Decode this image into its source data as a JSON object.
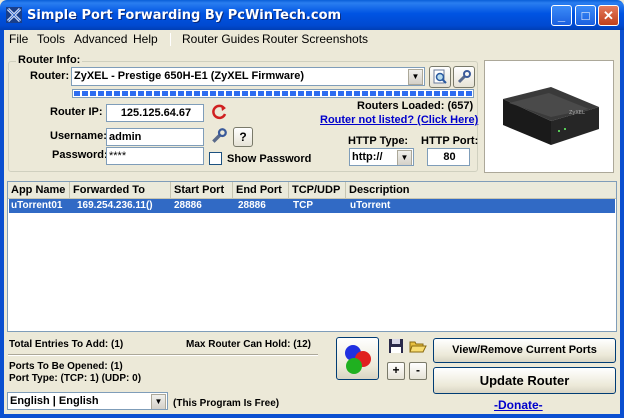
{
  "window": {
    "title": "Simple Port Forwarding By PcWinTech.com",
    "minimize": "_",
    "maximize": "□",
    "close": "✕"
  },
  "menu": {
    "file": "File",
    "tools": "Tools",
    "advanced": "Advanced",
    "help": "Help",
    "router_guides": "Router Guides",
    "router_screenshots": "Router Screenshots"
  },
  "router_info": {
    "group_label": "Router Info:",
    "router_label": "Router:",
    "router_value": "ZyXEL - Prestige 650H-E1 (ZyXEL Firmware)",
    "router_ip_label": "Router IP:",
    "router_ip_value": "125.125.64.67",
    "routers_loaded": "Routers Loaded: (657)",
    "router_not_listed": "Router not listed? (Click Here)",
    "username_label": "Username:",
    "username_value": "admin",
    "password_label": "Password:",
    "password_value": "****",
    "show_password_label": "Show Password",
    "help_button": "?",
    "http_type_label": "HTTP Type:",
    "http_type_value": "http://",
    "http_port_label": "HTTP Port:",
    "http_port_value": "80"
  },
  "table": {
    "columns": [
      "App Name",
      "Forwarded To",
      "Start Port",
      "End Port",
      "TCP/UDP",
      "Description"
    ],
    "rows": [
      {
        "app_name": "uTorrent01",
        "forwarded_to": "169.254.236.11()",
        "start_port": "28886",
        "end_port": "28886",
        "protocol": "TCP",
        "description": "uTorrent"
      }
    ]
  },
  "footer": {
    "total_entries": "Total Entries To Add: (1)",
    "max_router": "Max Router Can Hold: (12)",
    "ports_opened": "Ports To Be Opened: (1)",
    "port_type": "Port Type: (TCP: 1) (UDP: 0)",
    "language_value": "English | English",
    "program_free": "(This Program Is Free)",
    "plus": "+",
    "minus": "-",
    "view_remove_button": "View/Remove Current Ports",
    "update_router_button": "Update Router",
    "donate": "-Donate-"
  },
  "colors": {
    "titlebar": "#0054e3",
    "selection": "#316ac5",
    "link": "#0000cc",
    "window_bg": "#ece9d8"
  },
  "icons": [
    "app-x-icon",
    "search-icon",
    "tools-icon",
    "refresh-icon",
    "save-icon",
    "open-folder-icon",
    "rgb-circles-icon",
    "router-device-image"
  ]
}
